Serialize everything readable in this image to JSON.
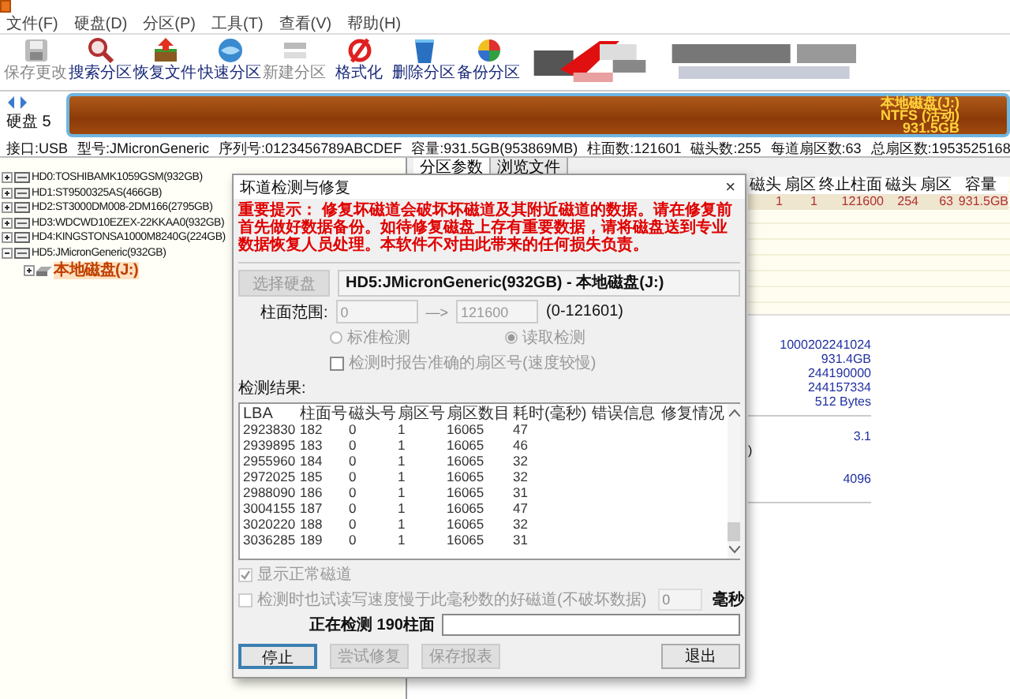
{
  "menu": [
    "文件(F)",
    "硬盘(D)",
    "分区(P)",
    "工具(T)",
    "查看(V)",
    "帮助(H)"
  ],
  "toolbar": [
    {
      "kind": "save",
      "label": "保存更改",
      "disabled": true
    },
    {
      "kind": "search",
      "label": "搜索分区",
      "disabled": false
    },
    {
      "kind": "recover",
      "label": "恢复文件",
      "disabled": false
    },
    {
      "kind": "quick",
      "label": "快速分区",
      "disabled": false
    },
    {
      "kind": "new",
      "label": "新建分区",
      "disabled": true
    },
    {
      "kind": "format",
      "label": "格式化",
      "disabled": false
    },
    {
      "kind": "delete",
      "label": "删除分区",
      "disabled": false
    },
    {
      "kind": "backup",
      "label": "备份分区",
      "disabled": false
    }
  ],
  "banner": {
    "kind": "picture"
  },
  "disk_bar": {
    "label": "硬盘 5",
    "partition_name": "本地磁盘(J:)",
    "partition_fs": "NTFS (活动)",
    "partition_size": "931.5GB"
  },
  "disk_info": [
    "接口:USB",
    "型号:JMicronGeneric",
    "序列号:0123456789ABCDEF",
    "容量:931.5GB(953869MB)",
    "柱面数:121601",
    "磁头数:255",
    "每道扇区数:63",
    "总扇区数:1953525168"
  ],
  "tree": [
    {
      "label": "HD0:TOSHIBAMK1059GSM(932GB)",
      "expanded": false
    },
    {
      "label": "HD1:ST9500325AS(466GB)",
      "expanded": false
    },
    {
      "label": "HD2:ST3000DM008-2DM166(2795GB)",
      "expanded": false
    },
    {
      "label": "HD3:WDCWD10EZEX-22KKAA0(932GB)",
      "expanded": false
    },
    {
      "label": "HD4:KINGSTONSA1000M8240G(224GB)",
      "expanded": false
    },
    {
      "label": "HD5:JMicronGeneric(932GB)",
      "expanded": true,
      "children": [
        {
          "label": "本地磁盘(J:)",
          "selected": true
        }
      ]
    }
  ],
  "tabs": [
    {
      "label": "分区参数",
      "selected": true
    },
    {
      "label": "浏览文件",
      "selected": false
    }
  ],
  "partition_table": {
    "columns": [
      "磁头",
      "扇区",
      "终止柱面",
      "磁头",
      "扇区",
      "容量"
    ],
    "rows": [
      [
        "1",
        "1",
        "121600",
        "254",
        "63",
        "931.5GB"
      ]
    ]
  },
  "details": [
    "1000202241024",
    "931.4GB",
    "244190000",
    "244157334",
    "512 Bytes"
  ],
  "details_2": {
    "fragment": ")",
    "values": [
      "3.1",
      "4096"
    ]
  },
  "dialog": {
    "title": "坏道检测与修复",
    "close": "×",
    "warning": "重要提示：  修复坏磁道会破坏坏磁道及其附近磁道的数据。请在修复前首先做好数据备份。如待修复磁盘上存有重要数据，请将磁盘送到专业数据恢复人员处理。本软件不对由此带来的任何损失负责。",
    "select_button": {
      "label": "选择硬盘",
      "disabled": true
    },
    "disk_field": "HD5:JMicronGeneric(932GB) - 本地磁盘(J:)",
    "range_label": "柱面范围:",
    "range_from": "0",
    "range_arrow": "—>",
    "range_to": "121600",
    "range_hint": "(0-121601)",
    "modes": [
      {
        "label": "标准检测",
        "selected": false
      },
      {
        "label": "读取检测",
        "selected": true
      }
    ],
    "exact_option": {
      "label": "检测时报告准确的扇区号(速度较慢)",
      "checked": false
    },
    "results_label": "检测结果:",
    "results": {
      "columns": [
        "LBA",
        "柱面号",
        "磁头号",
        "扇区号",
        "扇区数目",
        "耗时(毫秒)",
        "错误信息",
        "修复情况"
      ],
      "rows": [
        [
          "2923830",
          "182",
          "0",
          "1",
          "16065",
          "47"
        ],
        [
          "2939895",
          "183",
          "0",
          "1",
          "16065",
          "46"
        ],
        [
          "2955960",
          "184",
          "0",
          "1",
          "16065",
          "32"
        ],
        [
          "2972025",
          "185",
          "0",
          "1",
          "16065",
          "32"
        ],
        [
          "2988090",
          "186",
          "0",
          "1",
          "16065",
          "31"
        ],
        [
          "3004155",
          "187",
          "0",
          "1",
          "16065",
          "47"
        ],
        [
          "3020220",
          "188",
          "0",
          "1",
          "16065",
          "32"
        ],
        [
          "3036285",
          "189",
          "0",
          "1",
          "16065",
          "31"
        ]
      ]
    },
    "show_normal": {
      "label": "显示正常磁道",
      "checked": true
    },
    "slow_option": {
      "label": "检测时也试读写速度慢于此毫秒数的好磁道(不破坏数据)",
      "checked": false,
      "value": "0",
      "unit": "毫秒"
    },
    "progress": {
      "text": "正在检测 190柱面",
      "level": 0
    },
    "buttons": [
      {
        "label": "停止",
        "disabled": false
      },
      {
        "label": "尝试修复",
        "disabled": true
      },
      {
        "label": "保存报表",
        "disabled": true
      },
      {
        "label": "退出",
        "disabled": false
      }
    ]
  }
}
